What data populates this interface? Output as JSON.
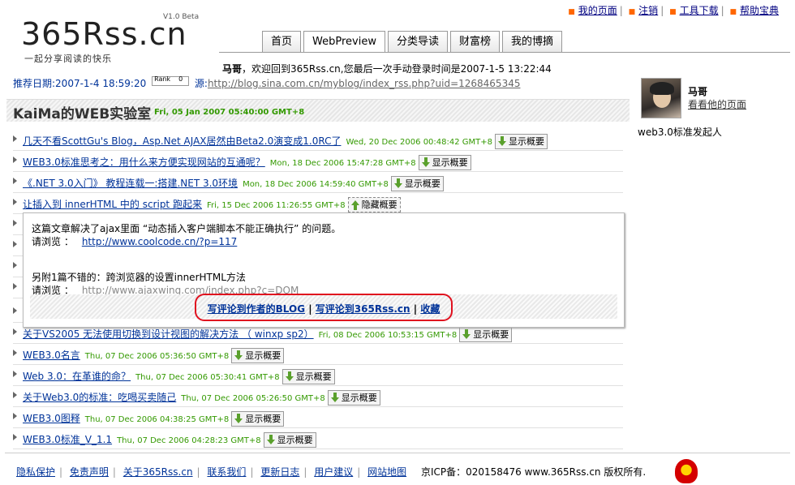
{
  "logo": {
    "text": "365Rss.cn",
    "slogan": "一起分享阅读的快乐",
    "version": "V1.0 Beta"
  },
  "top_links": [
    "我的页面",
    "注销",
    "工具下载",
    "帮助宝典"
  ],
  "tabs": [
    "首页",
    "WebPreview",
    "分类导读",
    "财富榜",
    "我的博摘"
  ],
  "welcome": {
    "user": "马哥",
    "text": "，欢迎回到365Rss.cn,您最后一次手动登录时间是2007-1-5 13:22:44"
  },
  "meta": {
    "recommend_label": "推荐日期:2007-1-4 18:59:20",
    "rank_label": "Rank",
    "rank_value": "0",
    "source_label": "源:",
    "source_url": "http://blog.sina.com.cn/myblog/index_rss.php?uid=1268465345"
  },
  "feed": {
    "title": "KaiMa的WEB实验室",
    "date": "Fri, 05 Jan 2007 05:40:00 GMT+8"
  },
  "items": [
    {
      "title": "几天不看ScottGu's Blog，Asp.Net AJAX居然由Beta2.0演变成1.0RC了",
      "date": "Wed, 20 Dec 2006 00:48:42 GMT+8",
      "button": "显示概要"
    },
    {
      "title": "WEB3.0标准思考之：用什么来方便实现网站的互通呢？",
      "date": "Mon, 18 Dec 2006 15:47:28 GMT+8",
      "button": "显示概要"
    },
    {
      "title": "《.NET 3.0入门》 教程连载一:搭建.NET 3.0环境",
      "date": "Mon, 18 Dec 2006 14:59:40 GMT+8",
      "button": "显示概要"
    },
    {
      "title": "让插入到 innerHTML 中的 script 跑起来",
      "date": "Fri, 15 Dec 2006 11:26:55 GMT+8",
      "button": "隐藏概要"
    },
    {
      "title": "关于VS2005 无法使用切换到设计视图的解决方法 （ winxp sp2）",
      "date": "Fri, 08 Dec 2006 10:53:15 GMT+8",
      "button": "显示概要"
    },
    {
      "title": "WEB3.0名言",
      "date": "Thu, 07 Dec 2006 05:36:50 GMT+8",
      "button": "显示概要"
    },
    {
      "title": "Web 3.0：在革谁的命？",
      "date": "Thu, 07 Dec 2006 05:30:41 GMT+8",
      "button": "显示概要"
    },
    {
      "title": "关于Web3.0的标准：吃喝买卖随己",
      "date": "Thu, 07 Dec 2006 05:26:50 GMT+8",
      "button": "显示概要"
    },
    {
      "title": "WEB3.0图释",
      "date": "Thu, 07 Dec 2006 04:38:25 GMT+8",
      "button": "显示概要"
    },
    {
      "title": "WEB3.0标准_V_1.1",
      "date": "Thu, 07 Dec 2006 04:28:23 GMT+8",
      "button": "显示概要"
    }
  ],
  "popup": {
    "line1": "这篇文章解决了ajax里面 “动态插入客户端脚本不能正确执行” 的问题。",
    "line2_label": "请浏览 ：",
    "line2_link": "http://www.coolcode.cn/?p=117",
    "line3": "另附1篇不错的：跨浏览器的设置innerHTML方法",
    "line4_label": "请浏览 ：",
    "line4_link": "http://www.ajaxwing.com/index.php?c=DOM",
    "action1": "写评论到作者的BLOG",
    "action2": "写评论到365Rss.cn",
    "action3": "收藏",
    "sep": " | "
  },
  "sidebar": {
    "name": "马哥",
    "page_link": "看看他的页面",
    "desc": "web3.0标准发起人"
  },
  "footer": {
    "links": [
      "隐私保护",
      "免责声明",
      "关于365Rss.cn",
      "联系我们",
      "更新日志",
      "用户建议",
      "网站地图"
    ],
    "icp": "京ICP备：020158476 www.365Rss.cn 版权所有."
  },
  "colors": {
    "link": "#003399",
    "date": "#339900",
    "highlight": "#e0101e",
    "bullet": "#ff6600"
  }
}
